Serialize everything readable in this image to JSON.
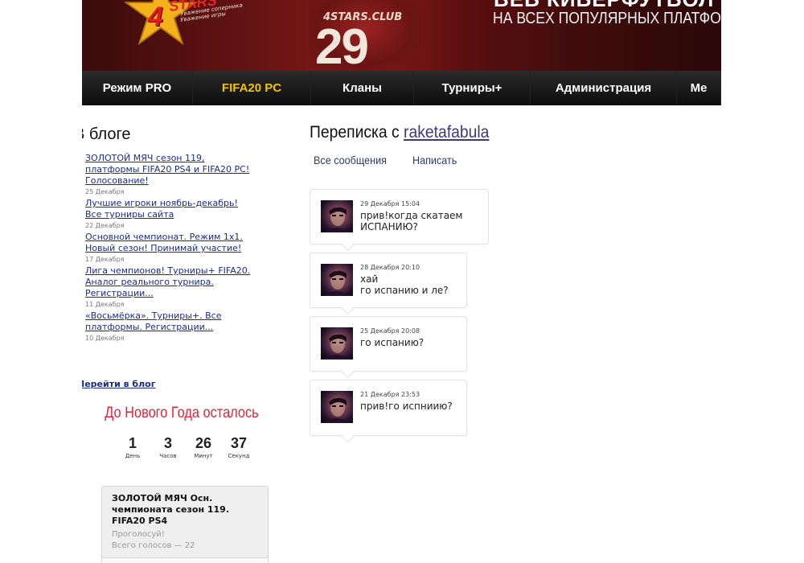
{
  "banner": {
    "logo_number": "4",
    "logo_word": "STARS",
    "logo_tagline_1": "Уважение соперника",
    "logo_tagline_2": "Уважение игры",
    "jersey_club": "4STARS.CLUB",
    "jersey_number": "29",
    "headline_top": "ВЕБ КИБЕРФУТБОЛ",
    "headline_sub": "НА ВСЕХ ПОПУЛЯРНЫХ ПЛАТФОРМАХ"
  },
  "nav": {
    "items": [
      {
        "label": "Режим PRO"
      },
      {
        "label": "FIFA20 PC"
      },
      {
        "label": "Кланы"
      },
      {
        "label": "Турниры+"
      },
      {
        "label": "Администрация"
      },
      {
        "label": "Ме"
      }
    ],
    "active_color": "#f2c400"
  },
  "blog": {
    "heading": "В блоге",
    "posts": [
      {
        "title": "ЗОЛОТОЙ МЯЧ сезон 119, платформы FIFA20 PS4 и FIFA20 PC! Голосование!",
        "date": "25 Декабря"
      },
      {
        "title": "Лучшие игроки ноябрь-декабрь! Все турниры сайта",
        "date": "22 Декабря"
      },
      {
        "title": "Основной чемпионат. Режим 1x1. Новый сезон! Принимай участие!",
        "date": "17 Декабря"
      },
      {
        "title": "Лига чемпионов! Турниры+ FIFA20. Аналог реального турнира. Регистрации...",
        "date": "11 Декабря"
      },
      {
        "title": "«Восьмёрка». Турниры+. Все платформы. Регистрации...",
        "date": "10 Декабря"
      }
    ],
    "more_link": "Перейти в блог"
  },
  "countdown": {
    "title": "До Нового Года осталось",
    "cells": [
      {
        "value": "1",
        "label": "День"
      },
      {
        "value": "3",
        "label": "Часов"
      },
      {
        "value": "26",
        "label": "Минут"
      },
      {
        "value": "37",
        "label": "Секунд"
      }
    ],
    "accent": "#e0253a"
  },
  "poll": {
    "title": "ЗОЛОТОЙ МЯЧ Осн. чемпионата сезон 119. FIFA20 PS4",
    "cta": "Проголосуй!",
    "votes": "Всего голосов — 22"
  },
  "conversation": {
    "title_prefix": "Переписка с ",
    "username": "raketafabula",
    "tabs": [
      {
        "label": "Все сообщения"
      },
      {
        "label": "Написать"
      }
    ],
    "messages": [
      {
        "date": "29 Декабря 15:04",
        "text": "прив!когда скатаем\nИСПАНИЮ?"
      },
      {
        "date": "28 Декабря 20:10",
        "text": "хай\nго испанию и ле?"
      },
      {
        "date": "25 Декабря 20:08",
        "text": "го испанию?"
      },
      {
        "date": "21 Декабря 23:53",
        "text": "прив!го испниию?"
      }
    ]
  }
}
